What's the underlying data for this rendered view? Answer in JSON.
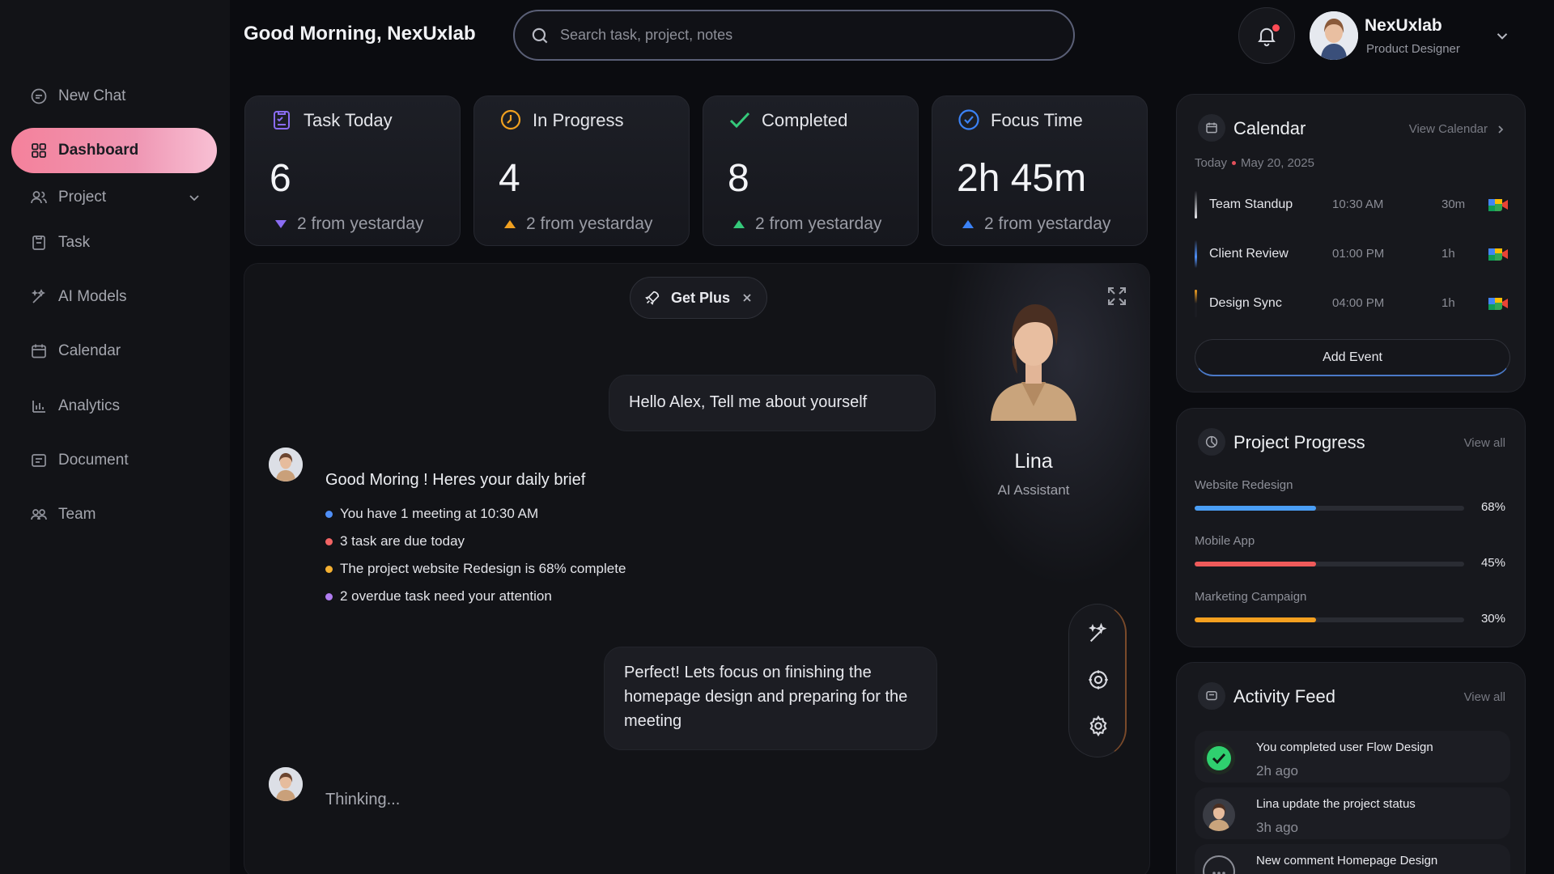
{
  "sidebar": {
    "items": [
      {
        "label": "New Chat",
        "icon": "chat-icon"
      },
      {
        "label": "Dashboard",
        "icon": "grid-icon",
        "active": true
      },
      {
        "label": "Project",
        "icon": "users-icon",
        "has_submenu": true
      },
      {
        "label": "Task",
        "icon": "task-icon"
      },
      {
        "label": "AI Models",
        "icon": "magic-icon"
      },
      {
        "label": "Calendar",
        "icon": "calendar-icon"
      },
      {
        "label": "Analytics",
        "icon": "bar-chart-icon"
      },
      {
        "label": "Document",
        "icon": "document-icon"
      },
      {
        "label": "Team",
        "icon": "team-icon"
      }
    ]
  },
  "header": {
    "greeting": "Good Morning, NexUxlab",
    "search_placeholder": "Search task, project, notes",
    "profile": {
      "name": "NexUxlab",
      "role": "Product Designer"
    }
  },
  "stats": [
    {
      "label": "Task Today",
      "value": "6",
      "delta": "2 from yestarday",
      "direction": "down",
      "accent": "#8a6cf2"
    },
    {
      "label": "In Progress",
      "value": "4",
      "delta": "2 from yestarday",
      "direction": "up",
      "accent": "#f0a020"
    },
    {
      "label": "Completed",
      "value": "8",
      "delta": "2 from yestarday",
      "direction": "up",
      "accent": "#35c97a"
    },
    {
      "label": "Focus Time",
      "value": "2h 45m",
      "delta": "2 from yestarday",
      "direction": "up",
      "accent": "#3b82f6"
    }
  ],
  "chat": {
    "get_plus": "Get Plus",
    "user_message_1": "Hello Alex, Tell me about yourself",
    "brief_title": "Good Moring ! Heres your daily brief",
    "brief_items": [
      {
        "text": "You have 1 meeting at 10:30 AM",
        "color": "#4f8ff7"
      },
      {
        "text": "3 task are due today",
        "color": "#f26464"
      },
      {
        "text": "The project website Redesign is 68% complete",
        "color": "#f4b032"
      },
      {
        "text": "2 overdue task need your attention",
        "color": "#b07cf0"
      }
    ],
    "user_message_2": "Perfect! Lets focus on finishing the homepage design and preparing for the meeting",
    "thinking": "Thinking...",
    "assistant": {
      "name": "Lina",
      "role": "AI Assistant"
    }
  },
  "calendar": {
    "title": "Calendar",
    "view_link": "View Calendar",
    "today_label": "Today",
    "date": "May 20, 2025",
    "events": [
      {
        "name": "Team Standup",
        "time": "10:30 AM",
        "duration": "30m",
        "color": "#e9eaee"
      },
      {
        "name": "Client Review",
        "time": "01:00 PM",
        "duration": "1h",
        "color": "#4f8ff7"
      },
      {
        "name": "Design Sync",
        "time": "04:00 PM",
        "duration": "1h",
        "color": "#f4a020"
      }
    ],
    "add_event": "Add Event"
  },
  "project_progress": {
    "title": "Project Progress",
    "view_link": "View all",
    "items": [
      {
        "name": "Website Redesign",
        "percent_label": "68%",
        "fill_fraction": 0.45,
        "color": "#4a9ef5"
      },
      {
        "name": "Mobile App",
        "percent_label": "45%",
        "fill_fraction": 0.45,
        "color": "#ef5a5a"
      },
      {
        "name": "Marketing Campaign",
        "percent_label": "30%",
        "fill_fraction": 0.45,
        "color": "#f4a020"
      }
    ]
  },
  "activity_feed": {
    "title": "Activity Feed",
    "view_link": "View all",
    "items": [
      {
        "text": "You completed user Flow Design",
        "time": "2h ago",
        "icon": "check-circle-icon"
      },
      {
        "text": "Lina update the project status",
        "time": "3h ago",
        "icon": "avatar"
      },
      {
        "text": "New comment Homepage Design",
        "time": "",
        "icon": "comment-icon"
      }
    ]
  }
}
